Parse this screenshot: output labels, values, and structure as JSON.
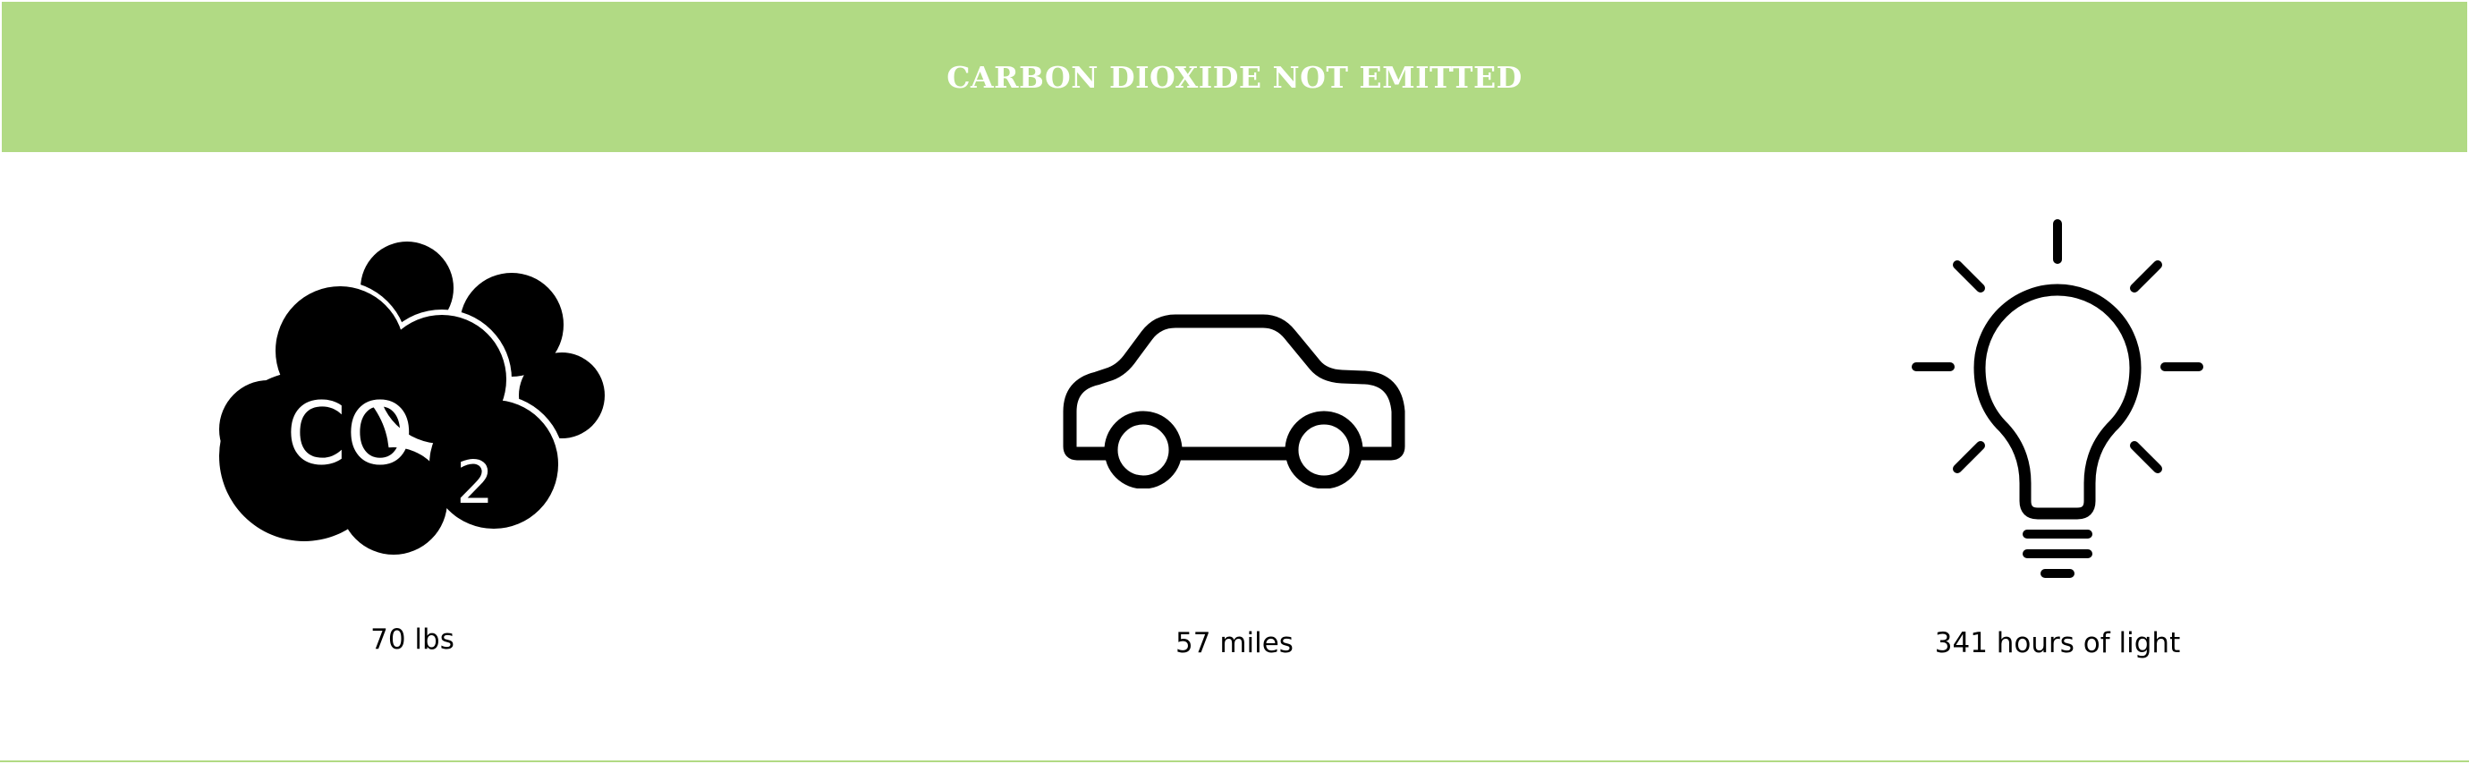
{
  "header": {
    "title": "CARBON DIOXIDE NOT EMITTED"
  },
  "stats": [
    {
      "icon": "co2-cloud-icon",
      "label": "70 lbs"
    },
    {
      "icon": "car-icon",
      "label": "57 miles"
    },
    {
      "icon": "light-bulb-icon",
      "label": "341 hours of light"
    }
  ],
  "co2_icon_text": {
    "main": "CO",
    "subscript": "2"
  },
  "colors": {
    "banner": "#b1da84",
    "banner_text": "#ffffff",
    "icon": "#000000",
    "text": "#000000"
  }
}
